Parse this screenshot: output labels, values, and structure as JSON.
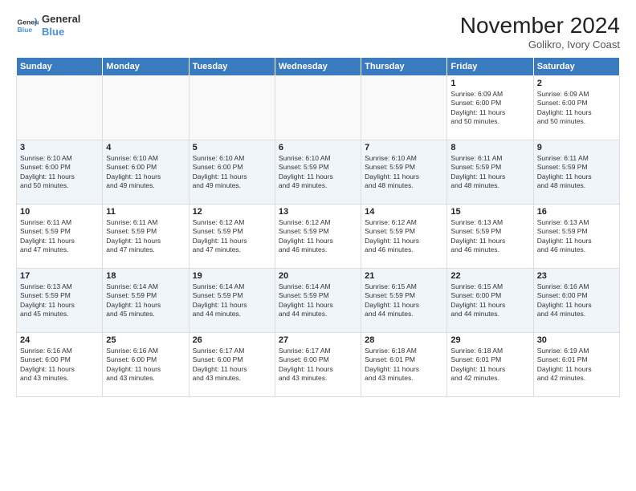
{
  "header": {
    "logo_line1": "General",
    "logo_line2": "Blue",
    "month": "November 2024",
    "location": "Golikro, Ivory Coast"
  },
  "weekdays": [
    "Sunday",
    "Monday",
    "Tuesday",
    "Wednesday",
    "Thursday",
    "Friday",
    "Saturday"
  ],
  "weeks": [
    [
      {
        "day": "",
        "info": ""
      },
      {
        "day": "",
        "info": ""
      },
      {
        "day": "",
        "info": ""
      },
      {
        "day": "",
        "info": ""
      },
      {
        "day": "",
        "info": ""
      },
      {
        "day": "1",
        "info": "Sunrise: 6:09 AM\nSunset: 6:00 PM\nDaylight: 11 hours\nand 50 minutes."
      },
      {
        "day": "2",
        "info": "Sunrise: 6:09 AM\nSunset: 6:00 PM\nDaylight: 11 hours\nand 50 minutes."
      }
    ],
    [
      {
        "day": "3",
        "info": "Sunrise: 6:10 AM\nSunset: 6:00 PM\nDaylight: 11 hours\nand 50 minutes."
      },
      {
        "day": "4",
        "info": "Sunrise: 6:10 AM\nSunset: 6:00 PM\nDaylight: 11 hours\nand 49 minutes."
      },
      {
        "day": "5",
        "info": "Sunrise: 6:10 AM\nSunset: 6:00 PM\nDaylight: 11 hours\nand 49 minutes."
      },
      {
        "day": "6",
        "info": "Sunrise: 6:10 AM\nSunset: 5:59 PM\nDaylight: 11 hours\nand 49 minutes."
      },
      {
        "day": "7",
        "info": "Sunrise: 6:10 AM\nSunset: 5:59 PM\nDaylight: 11 hours\nand 48 minutes."
      },
      {
        "day": "8",
        "info": "Sunrise: 6:11 AM\nSunset: 5:59 PM\nDaylight: 11 hours\nand 48 minutes."
      },
      {
        "day": "9",
        "info": "Sunrise: 6:11 AM\nSunset: 5:59 PM\nDaylight: 11 hours\nand 48 minutes."
      }
    ],
    [
      {
        "day": "10",
        "info": "Sunrise: 6:11 AM\nSunset: 5:59 PM\nDaylight: 11 hours\nand 47 minutes."
      },
      {
        "day": "11",
        "info": "Sunrise: 6:11 AM\nSunset: 5:59 PM\nDaylight: 11 hours\nand 47 minutes."
      },
      {
        "day": "12",
        "info": "Sunrise: 6:12 AM\nSunset: 5:59 PM\nDaylight: 11 hours\nand 47 minutes."
      },
      {
        "day": "13",
        "info": "Sunrise: 6:12 AM\nSunset: 5:59 PM\nDaylight: 11 hours\nand 46 minutes."
      },
      {
        "day": "14",
        "info": "Sunrise: 6:12 AM\nSunset: 5:59 PM\nDaylight: 11 hours\nand 46 minutes."
      },
      {
        "day": "15",
        "info": "Sunrise: 6:13 AM\nSunset: 5:59 PM\nDaylight: 11 hours\nand 46 minutes."
      },
      {
        "day": "16",
        "info": "Sunrise: 6:13 AM\nSunset: 5:59 PM\nDaylight: 11 hours\nand 46 minutes."
      }
    ],
    [
      {
        "day": "17",
        "info": "Sunrise: 6:13 AM\nSunset: 5:59 PM\nDaylight: 11 hours\nand 45 minutes."
      },
      {
        "day": "18",
        "info": "Sunrise: 6:14 AM\nSunset: 5:59 PM\nDaylight: 11 hours\nand 45 minutes."
      },
      {
        "day": "19",
        "info": "Sunrise: 6:14 AM\nSunset: 5:59 PM\nDaylight: 11 hours\nand 44 minutes."
      },
      {
        "day": "20",
        "info": "Sunrise: 6:14 AM\nSunset: 5:59 PM\nDaylight: 11 hours\nand 44 minutes."
      },
      {
        "day": "21",
        "info": "Sunrise: 6:15 AM\nSunset: 5:59 PM\nDaylight: 11 hours\nand 44 minutes."
      },
      {
        "day": "22",
        "info": "Sunrise: 6:15 AM\nSunset: 6:00 PM\nDaylight: 11 hours\nand 44 minutes."
      },
      {
        "day": "23",
        "info": "Sunrise: 6:16 AM\nSunset: 6:00 PM\nDaylight: 11 hours\nand 44 minutes."
      }
    ],
    [
      {
        "day": "24",
        "info": "Sunrise: 6:16 AM\nSunset: 6:00 PM\nDaylight: 11 hours\nand 43 minutes."
      },
      {
        "day": "25",
        "info": "Sunrise: 6:16 AM\nSunset: 6:00 PM\nDaylight: 11 hours\nand 43 minutes."
      },
      {
        "day": "26",
        "info": "Sunrise: 6:17 AM\nSunset: 6:00 PM\nDaylight: 11 hours\nand 43 minutes."
      },
      {
        "day": "27",
        "info": "Sunrise: 6:17 AM\nSunset: 6:00 PM\nDaylight: 11 hours\nand 43 minutes."
      },
      {
        "day": "28",
        "info": "Sunrise: 6:18 AM\nSunset: 6:01 PM\nDaylight: 11 hours\nand 43 minutes."
      },
      {
        "day": "29",
        "info": "Sunrise: 6:18 AM\nSunset: 6:01 PM\nDaylight: 11 hours\nand 42 minutes."
      },
      {
        "day": "30",
        "info": "Sunrise: 6:19 AM\nSunset: 6:01 PM\nDaylight: 11 hours\nand 42 minutes."
      }
    ]
  ]
}
